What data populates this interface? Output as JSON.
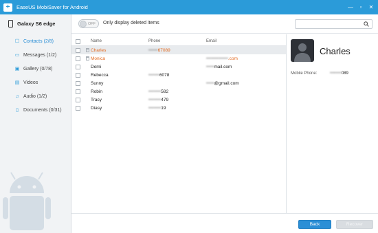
{
  "window": {
    "title": "EaseUS MobiSaver for Android",
    "controls": {
      "minimize": "—",
      "restore": "▫",
      "close": "✕"
    }
  },
  "sidebar": {
    "device": "Galaxy S6 edge",
    "items": [
      {
        "label": "Contacts (2/8)",
        "icon": "contacts-icon",
        "glyph": "☐"
      },
      {
        "label": "Messages (1/2)",
        "icon": "messages-icon",
        "glyph": "▭"
      },
      {
        "label": "Gallery (0/78)",
        "icon": "gallery-icon",
        "glyph": "▣"
      },
      {
        "label": "Videos",
        "icon": "videos-icon",
        "glyph": "▤"
      },
      {
        "label": "Audio (1/2)",
        "icon": "audio-icon",
        "glyph": "♫"
      },
      {
        "label": "Documents (0/31)",
        "icon": "documents-icon",
        "glyph": "▯"
      }
    ]
  },
  "toolbar": {
    "toggle_state": "OFF",
    "toggle_text": "Only display deleted items",
    "search_placeholder": ""
  },
  "table": {
    "columns": {
      "name": "Name",
      "phone": "Phone",
      "email": "Email"
    },
    "rows": [
      {
        "name": "Charles",
        "phone": "67089",
        "email": "",
        "deleted": true,
        "selected": true
      },
      {
        "name": "Monica",
        "phone": "",
        "email": ".com",
        "deleted": true,
        "selected": false
      },
      {
        "name": "Demi",
        "phone": "",
        "email": "mail.com",
        "deleted": false,
        "selected": false
      },
      {
        "name": "Rebecca",
        "phone": "6078",
        "email": "",
        "deleted": false,
        "selected": false
      },
      {
        "name": "Sunny",
        "phone": "",
        "email": "@gmail.com",
        "deleted": false,
        "selected": false
      },
      {
        "name": "Robin",
        "phone": "582",
        "email": "",
        "deleted": false,
        "selected": false
      },
      {
        "name": "Tracy",
        "phone": "479",
        "email": "",
        "deleted": false,
        "selected": false
      },
      {
        "name": "Diasy",
        "phone": "19",
        "email": "",
        "deleted": false,
        "selected": false
      }
    ]
  },
  "details": {
    "name": "Charles",
    "fields": [
      {
        "label": "Mobile Phone:",
        "value": "089"
      }
    ]
  },
  "footer": {
    "back": "Back",
    "recover": "Recover"
  },
  "colors": {
    "accent": "#2b9bd9",
    "deleted_text": "#e2691f",
    "selected_row": "#e8ebee"
  }
}
